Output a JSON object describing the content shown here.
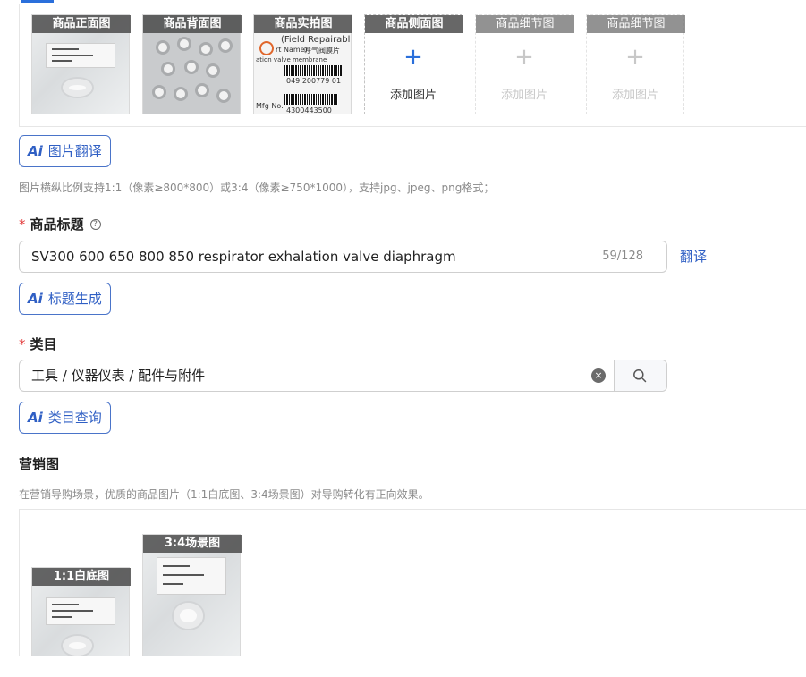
{
  "product_images": {
    "slots": [
      {
        "label": "商品正面图",
        "state": "filled"
      },
      {
        "label": "商品背面图",
        "state": "filled"
      },
      {
        "label": "商品实拍图",
        "state": "filled"
      },
      {
        "label": "商品侧面图",
        "state": "empty",
        "add_text": "添加图片"
      },
      {
        "label": "商品细节图",
        "state": "disabled",
        "add_text": "添加图片"
      },
      {
        "label": "商品细节图",
        "state": "disabled",
        "add_text": "添加图片"
      }
    ],
    "photo_text": {
      "field_repair": "(Field Repairabl",
      "name_label": "rt Name):",
      "name_cn": "呼气阀膜片",
      "valve": "ation valve membrane",
      "code": "049 200779 01",
      "mfg": "Mfg No.",
      "lot": "4300443500"
    },
    "translate_button": "图片翻译",
    "hint": "图片横纵比例支持1:1（像素≥800*800）或3:4（像素≥750*1000），支持jpg、jpeg、png格式；"
  },
  "title_field": {
    "label": "商品标题",
    "required": true,
    "value": "SV300 600 650 800 850 respirator exhalation valve diaphragm",
    "counter": "59/128",
    "translate_link": "翻译",
    "generate_button": "标题生成"
  },
  "category_field": {
    "label": "类目",
    "required": true,
    "value": "工具 / 仪器仪表 / 配件与附件",
    "query_button": "类目查询"
  },
  "marketing": {
    "label": "营销图",
    "hint": "在营销导购场景，优质的商品图片（1:1白底图、3:4场景图）对导购转化有正向效果。",
    "images": [
      {
        "label": "1:1白底图"
      },
      {
        "label": "3:4场景图"
      }
    ]
  },
  "icons": {
    "ai": "Ai",
    "plus": "+",
    "clear": "×",
    "help": "?"
  },
  "colors": {
    "accent": "#2a6fdb",
    "required": "#e23c3c",
    "hint": "#8a8a8a"
  }
}
